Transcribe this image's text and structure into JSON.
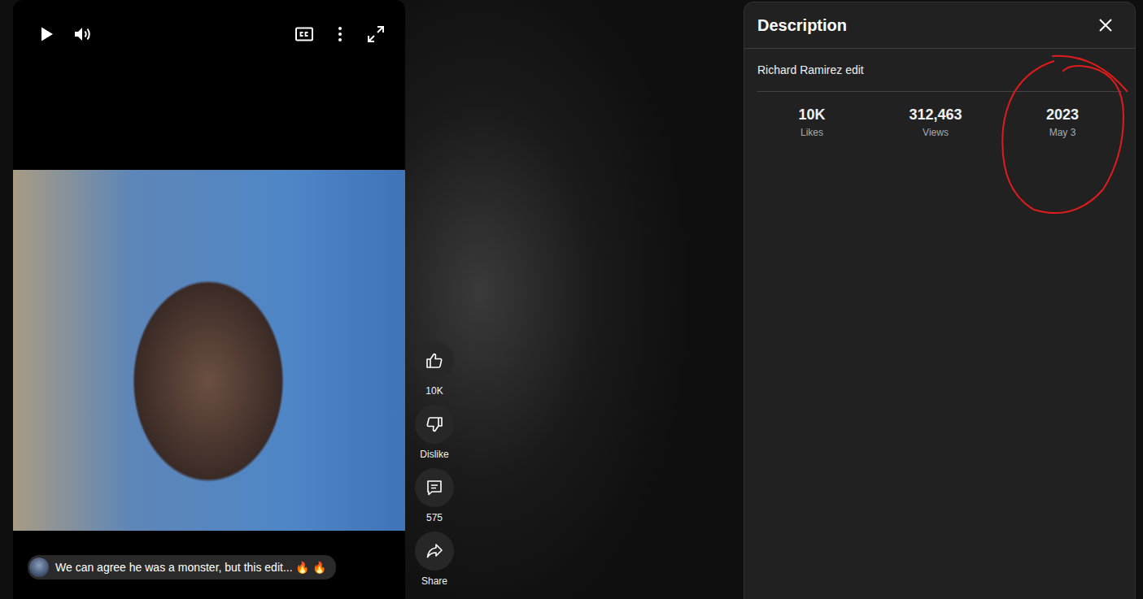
{
  "player": {
    "comment": {
      "text": "We can agree he was a monster, but this edit... 🔥 🔥"
    }
  },
  "actions": [
    {
      "kind": "like",
      "label": "10K"
    },
    {
      "kind": "dislike",
      "label": "Dislike"
    },
    {
      "kind": "comments",
      "label": "575"
    },
    {
      "kind": "share",
      "label": "Share"
    }
  ],
  "description": {
    "title": "Description",
    "text": "Richard Ramirez edit",
    "stats": [
      {
        "value": "10K",
        "label": "Likes"
      },
      {
        "value": "312,463",
        "label": "Views"
      },
      {
        "value": "2023",
        "label": "May 3"
      }
    ]
  }
}
